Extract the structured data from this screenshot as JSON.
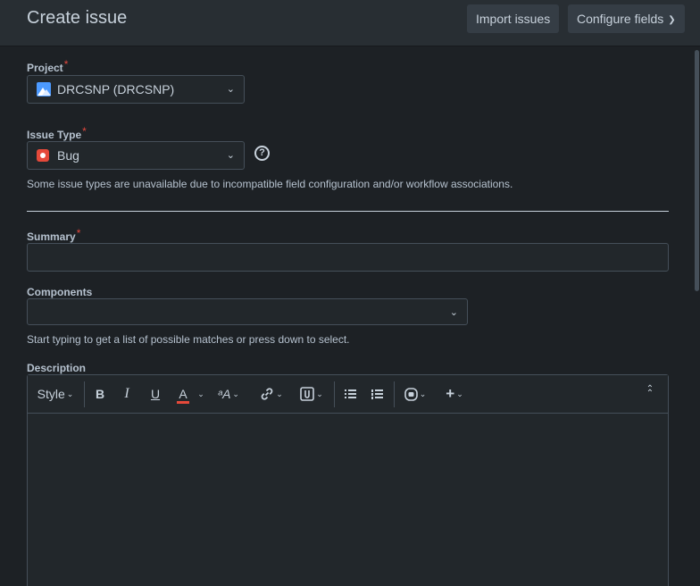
{
  "header": {
    "title": "Create issue",
    "import_label": "Import issues",
    "configure_label": "Configure fields"
  },
  "form": {
    "project": {
      "label": "Project",
      "required_mark": "*",
      "value": "DRCSNP (DRCSNP)",
      "icon": "project-avatar-icon"
    },
    "issue_type": {
      "label": "Issue Type",
      "required_mark": "*",
      "value": "Bug",
      "icon": "bug-icon",
      "help_glyph": "?",
      "hint": "Some issue types are unavailable due to incompatible field configuration and/or workflow associations."
    },
    "summary": {
      "label": "Summary",
      "required_mark": "*",
      "value": ""
    },
    "components": {
      "label": "Components",
      "value": "",
      "hint": "Start typing to get a list of possible matches or press down to select."
    },
    "description": {
      "label": "Description",
      "value": "",
      "toolbar": {
        "style_label": "Style",
        "bold": "B",
        "italic": "I",
        "underline": "U",
        "text_color": "A",
        "text_size": "ᵃA"
      }
    }
  },
  "colors": {
    "background": "#1d2125",
    "header": "#282e33",
    "button": "#353d45",
    "required": "#e2483d",
    "bug": "#e5493a",
    "project_icon": "#4c9aff"
  }
}
